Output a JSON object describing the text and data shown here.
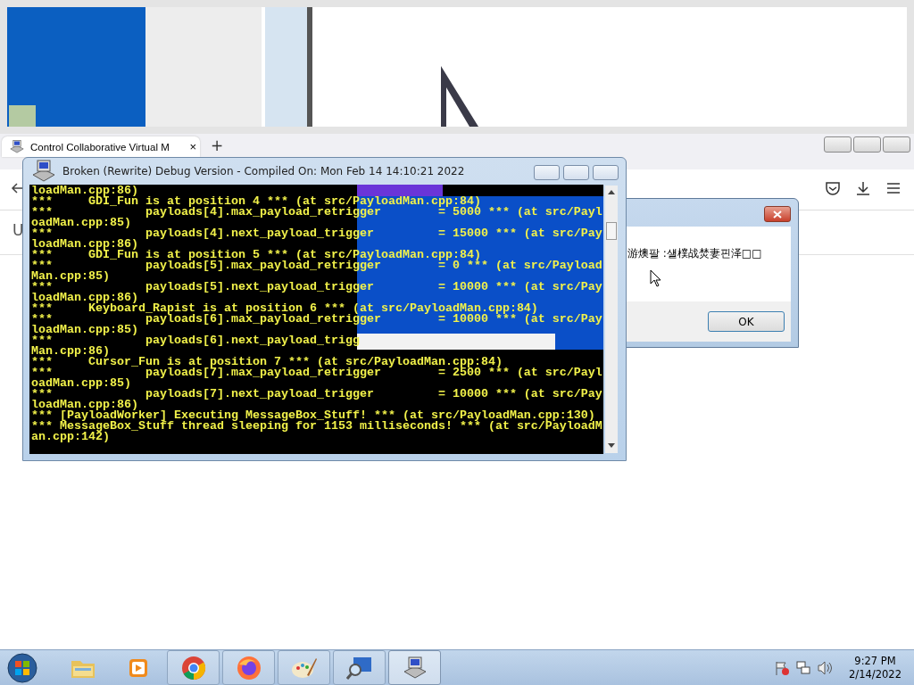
{
  "browser": {
    "tab": {
      "title": "Control Collaborative Virtual M",
      "close": "×"
    },
    "new_tab": "+",
    "page_text": "U"
  },
  "console": {
    "title": "Broken (Rewrite) Debug Version - Compiled On: Mon Feb 14 14:10:21 2022",
    "lines": [
      "loadMan.cpp:86)",
      "***     GDI_Fun is at position 4 *** (at src/PayloadMan.cpp:84)",
      "***             payloads[4].max_payload_retrigger        = 5000 *** (at src/Payl",
      "oadMan.cpp:85)",
      "***             payloads[4].next_payload_trigger         = 15000 *** (at src/Pay",
      "loadMan.cpp:86)",
      "***     GDI_Fun is at position 5 *** (at src/PayloadMan.cpp:84)",
      "***             payloads[5].max_payload_retrigger        = 0 *** (at src/Payload",
      "Man.cpp:85)",
      "***             payloads[5].next_payload_trigger         = 10000 *** (at src/Pay",
      "loadMan.cpp:86)",
      "***     Keyboard_Rapist is at position 6 *** (at src/PayloadMan.cpp:84)",
      "***             payloads[6].max_payload_retrigger        = 10000 *** (at src/Pay",
      "loadMan.cpp:85)",
      "***             payloads[6].next_payload_trigg",
      "Man.cpp:86)",
      "***     Cursor_Fun is at position 7 *** (at src/PayloadMan.cpp:84)",
      "***             payloads[7].max_payload_retrigger        = 2500 *** (at src/Payl",
      "oadMan.cpp:85)",
      "***             payloads[7].next_payload_trigger         = 10000 *** (at src/Pay",
      "loadMan.cpp:86)",
      "*** [PayloadWorker] Executing MessageBox_Stuff! *** (at src/PayloadMan.cpp:130)",
      "*** MessageBox_Stuff thread sleeping for 1153 milliseconds! *** (at src/PayloadM",
      "an.cpp:142)"
    ]
  },
  "message_box": {
    "text": "游燠팔 :섈樸战焚妻핀泽□□",
    "button": "OK"
  },
  "taskbar": {
    "apps": [
      {
        "kind": "explorer",
        "selected": false
      },
      {
        "kind": "media",
        "selected": false
      },
      {
        "kind": "chrome",
        "selected": false
      },
      {
        "kind": "firefox",
        "selected": false
      },
      {
        "kind": "paint",
        "selected": false
      },
      {
        "kind": "magnifier",
        "selected": false
      },
      {
        "kind": "console",
        "selected": true
      }
    ],
    "time": "9:27 PM",
    "date": "2/14/2022"
  }
}
